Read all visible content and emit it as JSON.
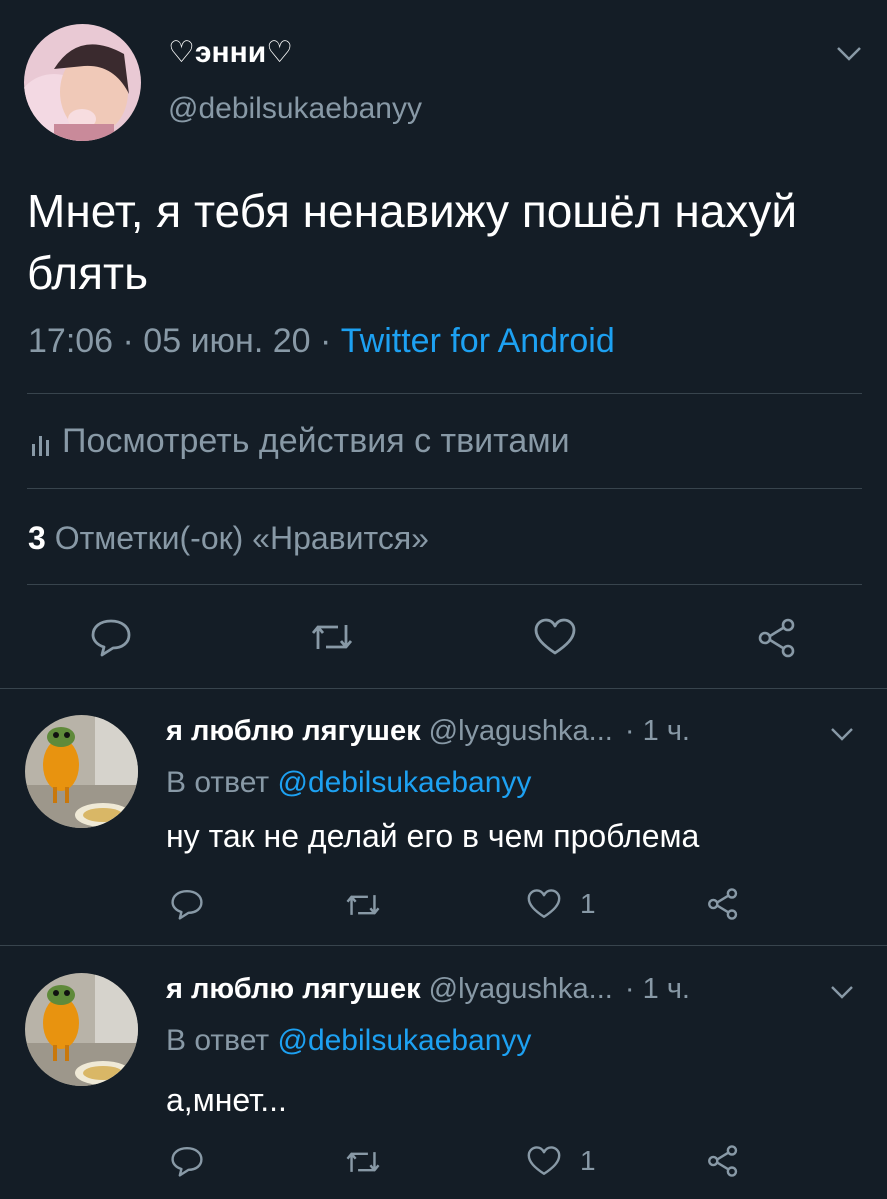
{
  "tweet": {
    "display_name": "♡энни♡",
    "handle": "@debilsukaebanyy",
    "text": "Мнет, я тебя ненавижу пошёл нахуй блять",
    "time": "17:06 · 05 июн. 20 · ",
    "source": "Twitter for Android",
    "activity_label": "Посмотреть действия с твитами",
    "likes_count": "3",
    "likes_label": " Отметки(-ок) «Нравится»"
  },
  "replies": [
    {
      "display_name": "я люблю лягушек",
      "handle": "@lyagushka...",
      "time": "· 1 ч.",
      "reply_prefix": "В ответ ",
      "reply_to": "@debilsukaebanyy",
      "text": "ну так не делай его в чем проблема",
      "like_count": "1"
    },
    {
      "display_name": "я люблю лягушек",
      "handle": "@lyagushka...",
      "time": "· 1 ч.",
      "reply_prefix": "В ответ ",
      "reply_to": "@debilsukaebanyy",
      "text": "а,мнет...",
      "like_count": "1"
    }
  ],
  "colors": {
    "background": "#141d26",
    "text": "#ffffff",
    "muted": "#8899a6",
    "link": "#1da1f2",
    "divider": "#38444d"
  },
  "icons": [
    "chevron-down-icon",
    "reply-icon",
    "retweet-icon",
    "heart-icon",
    "share-icon",
    "analytics-icon"
  ]
}
